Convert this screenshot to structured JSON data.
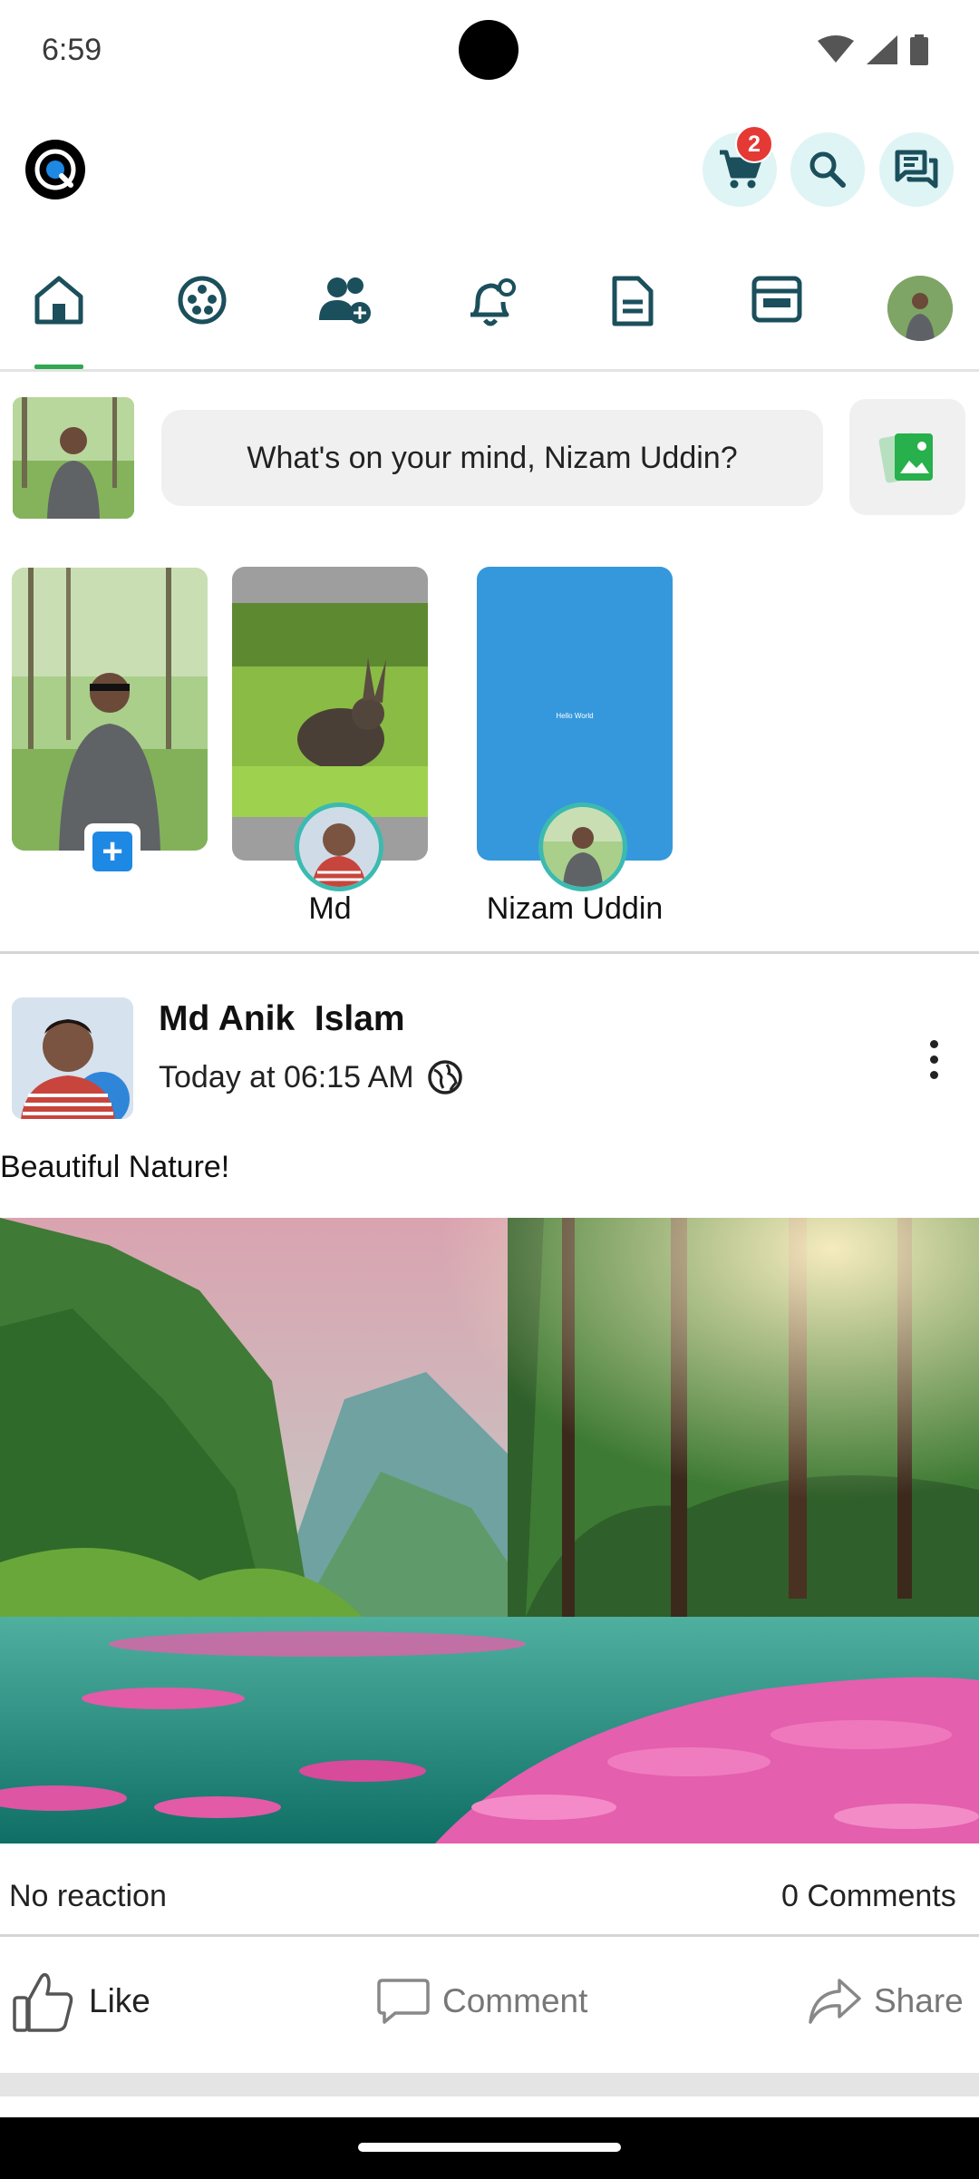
{
  "status_bar": {
    "time": "6:59"
  },
  "header": {
    "cart_badge": "2"
  },
  "tabs": [
    {
      "id": "home",
      "icon": "home-icon",
      "active": true
    },
    {
      "id": "reels",
      "icon": "film-reel-icon",
      "active": false
    },
    {
      "id": "friends",
      "icon": "add-friends-icon",
      "active": false
    },
    {
      "id": "notifications",
      "icon": "bell-icon",
      "active": false
    },
    {
      "id": "pages",
      "icon": "document-icon",
      "active": false
    },
    {
      "id": "marketplace",
      "icon": "store-icon",
      "active": false
    },
    {
      "id": "profile",
      "icon": "profile-avatar",
      "active": false
    }
  ],
  "composer": {
    "placeholder": "What's on your mind, Nizam Uddin?"
  },
  "stories": [
    {
      "name": "",
      "type": "create"
    },
    {
      "name": "Md"
    },
    {
      "name": "Nizam Uddin",
      "text": "Hello World"
    }
  ],
  "post": {
    "author": "Md Anik  Islam",
    "time": "Today at 06:15 AM",
    "privacy_icon": "globe-icon",
    "text": "Beautiful Nature!",
    "reactions": "No reaction",
    "comments": "0 Comments",
    "actions": {
      "like": "Like",
      "comment": "Comment",
      "share": "Share"
    }
  },
  "colors": {
    "accent": "#2fa84f",
    "icon_teal": "#1b4f5c",
    "header_btn_bg": "#dff4f5",
    "badge": "#e53935",
    "story_ring": "#3bbab0"
  }
}
